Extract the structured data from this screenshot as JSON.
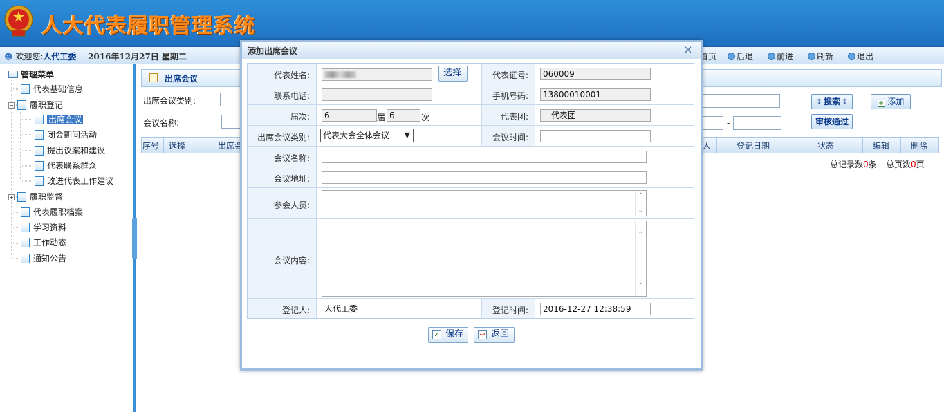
{
  "header": {
    "system_title": "人大代表履职管理系统",
    "welcome_prefix": "欢迎您:",
    "user_name": "人代工委",
    "date": "2016年12月27日  星期二",
    "nav": [
      "首页",
      "后退",
      "前进",
      "刷新",
      "退出"
    ]
  },
  "sidebar": {
    "title": "管理菜单",
    "items": [
      {
        "label": "代表基础信息"
      },
      {
        "label": "履职登记",
        "expanded": true,
        "children": [
          "出席会议",
          "闭会期间活动",
          "提出议案和建议",
          "代表联系群众",
          "改进代表工作建议"
        ],
        "selected_child": "出席会议"
      },
      {
        "label": "履职监督",
        "expanded": false
      },
      {
        "label": "代表履职档案"
      },
      {
        "label": "学习资料"
      },
      {
        "label": "工作动态"
      },
      {
        "label": "通知公告"
      }
    ]
  },
  "content": {
    "title": "出席会议",
    "filter_type_label": "出席会议类别:",
    "filter_name_label": "会议名称:",
    "date_separator": "-",
    "search_button": "搜索",
    "add_button": "添加",
    "approve_button": "审核通过",
    "columns": [
      "序号",
      "选择",
      "出席会",
      "人",
      "登记日期",
      "状态",
      "编辑",
      "删除"
    ],
    "total_records_prefix": "总记录数",
    "total_records": "0",
    "total_records_suffix": "条",
    "total_pages_prefix": "总页数",
    "total_pages": "0",
    "total_pages_suffix": "页"
  },
  "dialog": {
    "title": "添加出席会议",
    "close_symbol": "×",
    "fields": {
      "rep_name_label": "代表姓名:",
      "choose_button": "选择",
      "rep_id_label": "代表证号:",
      "rep_id_value": "060009",
      "phone_label": "联系电话:",
      "phone_value": "",
      "mobile_label": "手机号码:",
      "mobile_value": "13800010001",
      "term_label": "届次:",
      "term_value": "6",
      "term_unit": "届",
      "session_value": "6",
      "session_unit": "次",
      "delegation_label": "代表团:",
      "delegation_value": "一代表团",
      "meeting_type_label": "出席会议类别:",
      "meeting_type_value": "代表大会全体会议",
      "meeting_time_label": "会议时间:",
      "meeting_time_value": "",
      "meeting_name_label": "会议名称:",
      "meeting_name_value": "",
      "meeting_address_label": "会议地址:",
      "meeting_address_value": "",
      "attendees_label": "参会人员:",
      "meeting_content_label": "会议内容:",
      "registrar_label": "登记人:",
      "registrar_value": "人代工委",
      "register_time_label": "登记时间:",
      "register_time_value": "2016-12-27 12:38:59"
    },
    "save_button": "保存",
    "back_button": "返回"
  },
  "colors": {
    "banner": "#1e6fc0",
    "title_orange": "#ff8a1a",
    "accent_blue": "#3a78c4",
    "count_red": "#e00000"
  }
}
